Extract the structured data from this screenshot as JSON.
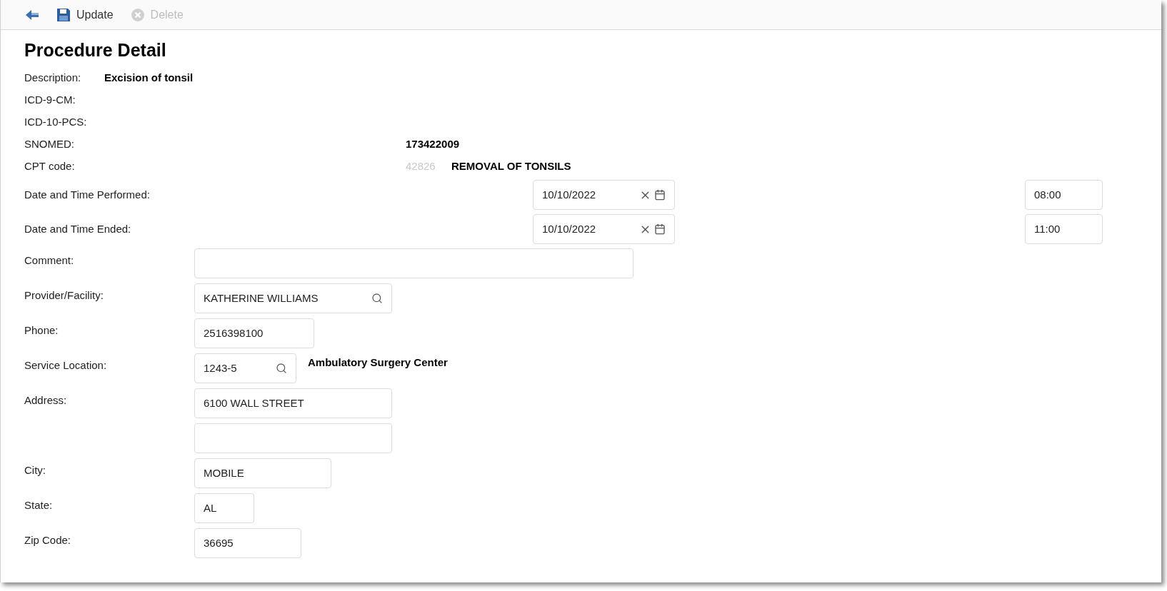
{
  "toolbar": {
    "buttons": [
      {
        "kind": "back",
        "disabled": false
      },
      {
        "kind": "save",
        "label": "Update",
        "disabled": false
      },
      {
        "kind": "delete",
        "label": "Delete",
        "disabled": true
      }
    ]
  },
  "title": "Procedure Detail",
  "info_rows": [
    {
      "kind": "inline",
      "label": "Description:",
      "value": "Excision of tonsil"
    },
    {
      "kind": "column",
      "label": "ICD-9-CM:"
    },
    {
      "kind": "column",
      "label": "ICD-10-PCS:"
    },
    {
      "kind": "column",
      "label": "SNOMED:",
      "value": "173422009"
    },
    {
      "kind": "column",
      "label": "CPT code:",
      "code": "42826",
      "value": "REMOVAL OF TONSILS"
    }
  ],
  "datetimes": [
    {
      "label": "Date and Time Performed:",
      "date": "10/10/2022",
      "time": "08:00"
    },
    {
      "label": "Date and Time Ended:",
      "date": "10/10/2022",
      "time": "11:00"
    }
  ],
  "fields": [
    {
      "kind": "text",
      "label": "Comment:"
    },
    {
      "kind": "search",
      "label": "Provider/Facility:",
      "value": "KATHERINE WILLIAMS"
    },
    {
      "kind": "text",
      "label": "Phone:",
      "value": "2516398100"
    },
    {
      "kind": "search",
      "label": "Service Location:",
      "value": "1243-5",
      "note": "Ambulatory Surgery Center"
    },
    {
      "kind": "text",
      "label": "Address:",
      "value": "6100 WALL STREET"
    },
    {
      "kind": "text"
    },
    {
      "kind": "text",
      "label": "City:",
      "value": "MOBILE"
    },
    {
      "kind": "text",
      "label": "State:",
      "value": "AL"
    },
    {
      "kind": "text",
      "label": "Zip Code:",
      "value": "36695"
    }
  ]
}
